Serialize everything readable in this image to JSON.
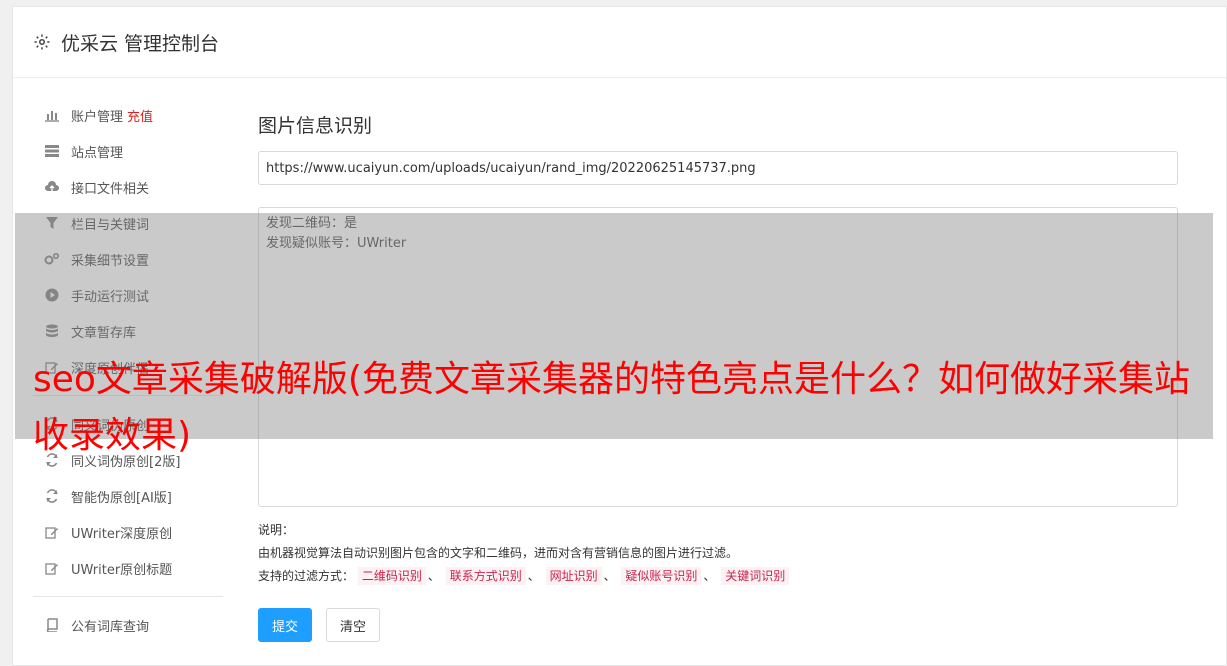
{
  "header": {
    "title": "优采云 管理控制台",
    "icon": "gear-icon"
  },
  "sidebar": {
    "items": [
      {
        "label": "账户管理",
        "extra": "充值",
        "icon": "bar-chart-icon"
      },
      {
        "label": "站点管理",
        "icon": "server-icon"
      },
      {
        "label": "接口文件相关",
        "icon": "cloud-upload-icon"
      },
      {
        "label": "栏目与关键词",
        "icon": "filter-icon"
      },
      {
        "label": "采集细节设置",
        "icon": "gears-icon"
      },
      {
        "label": "手动运行测试",
        "icon": "play-circle-icon"
      },
      {
        "label": "文章暂存库",
        "icon": "database-icon"
      },
      {
        "label": "深度原创伴侣",
        "icon": "edit-icon"
      },
      {
        "label": "同义词伪原创",
        "icon": "refresh-icon"
      },
      {
        "label": "同义词伪原创[2版]",
        "icon": "refresh-icon"
      },
      {
        "label": "智能伪原创[AI版]",
        "icon": "refresh-icon"
      },
      {
        "label": "UWriter深度原创",
        "icon": "edit-icon"
      },
      {
        "label": "UWriter原创标题",
        "icon": "edit-icon"
      },
      {
        "label": "公有词库查询",
        "icon": "book-icon"
      }
    ]
  },
  "main": {
    "title": "图片信息识别",
    "url_value": "https://www.ucaiyun.com/uploads/ucaiyun/rand_img/20220625145737.png",
    "result_text": "发现二维码：是\n发现疑似账号：UWriter",
    "desc_label": "说明：",
    "desc_text": "由机器视觉算法自动识别图片包含的文字和二维码，进而对含有营销信息的图片进行过滤。",
    "filter_label": "支持的过滤方式：",
    "filters": [
      "二维码识别",
      "联系方式识别",
      "网址识别",
      "疑似账号识别",
      "关键词识别"
    ],
    "submit_label": "提交",
    "clear_label": "清空"
  },
  "overlay": {
    "text": "seo文章采集破解版(免费文章采集器的特色亮点是什么？如何做好采集站收录效果)"
  },
  "colors": {
    "primary": "#1e9fff",
    "recharge": "#e02020",
    "tag_text": "#c7254e",
    "tag_bg": "#fdf1f3",
    "overlay_text": "#ff0000"
  }
}
